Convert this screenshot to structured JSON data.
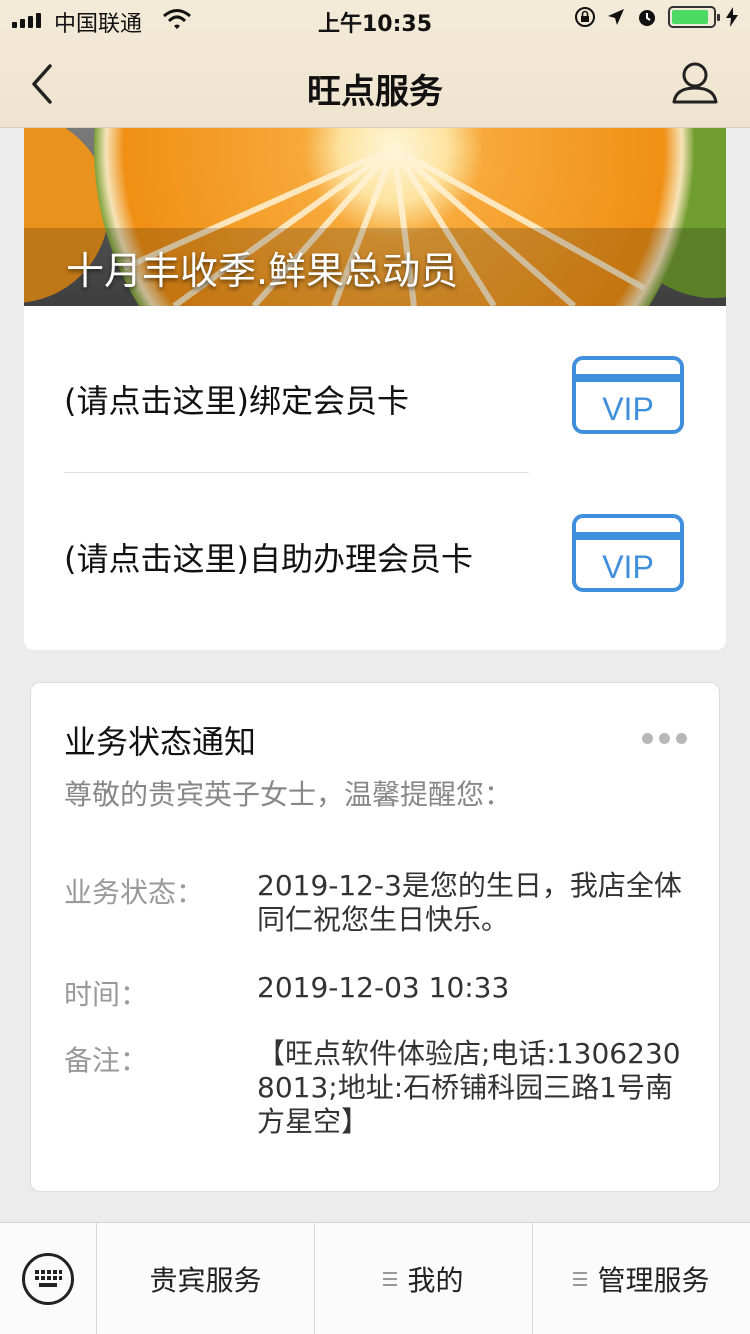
{
  "status_bar": {
    "carrier": "中国联通",
    "time": "上午10:35",
    "battery_level": 0.9
  },
  "nav": {
    "title": "旺点服务"
  },
  "banner": {
    "caption": "十月丰收季.鲜果总动员"
  },
  "member_actions": [
    {
      "label": "(请点击这里)绑定会员卡",
      "badge": "VIP"
    },
    {
      "label": "(请点击这里)自助办理会员卡",
      "badge": "VIP"
    }
  ],
  "notice": {
    "title": "业务状态通知",
    "greeting": "尊敬的贵宾英子女士，温馨提醒您：",
    "fields": [
      {
        "label": "业务状态：",
        "value": "2019-12-3是您的生日，我店全体同仁祝您生日快乐。"
      },
      {
        "label": "时间：",
        "value": "2019-12-03 10:33"
      },
      {
        "label": "备注：",
        "value": "【旺点软件体验店;电话:13062308013;地址:石桥铺科园三路1号南方星空】"
      }
    ]
  },
  "bottom_menu": [
    {
      "label": "贵宾服务"
    },
    {
      "label": "我的"
    },
    {
      "label": "管理服务"
    }
  ],
  "colors": {
    "vip_blue": "#3f8fdc",
    "nav_bg": "#f1e7d3",
    "battery_green": "#4cd964"
  }
}
